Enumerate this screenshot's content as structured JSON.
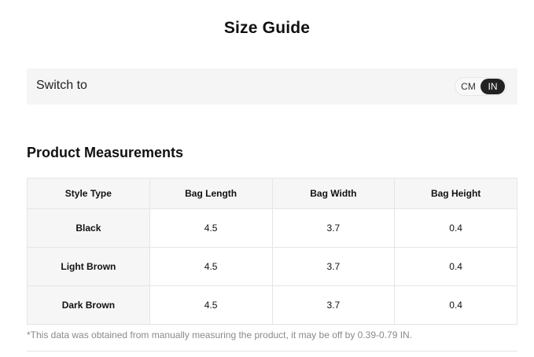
{
  "title": "Size Guide",
  "switch": {
    "label": "Switch to",
    "options": [
      "CM",
      "IN"
    ],
    "selected": "IN"
  },
  "section_title": "Product Measurements",
  "table": {
    "headers": [
      "Style Type",
      "Bag Length",
      "Bag Width",
      "Bag Height"
    ],
    "rows": [
      [
        "Black",
        "4.5",
        "3.7",
        "0.4"
      ],
      [
        "Light Brown",
        "4.5",
        "3.7",
        "0.4"
      ],
      [
        "Dark Brown",
        "4.5",
        "3.7",
        "0.4"
      ]
    ]
  },
  "note": "*This data was obtained from manually measuring the product, it may be off by 0.39-0.79 IN.",
  "colors": {
    "toggle_active_bg": "#222222",
    "panel_bg": "#f5f5f5",
    "border": "#e5e5e5"
  }
}
